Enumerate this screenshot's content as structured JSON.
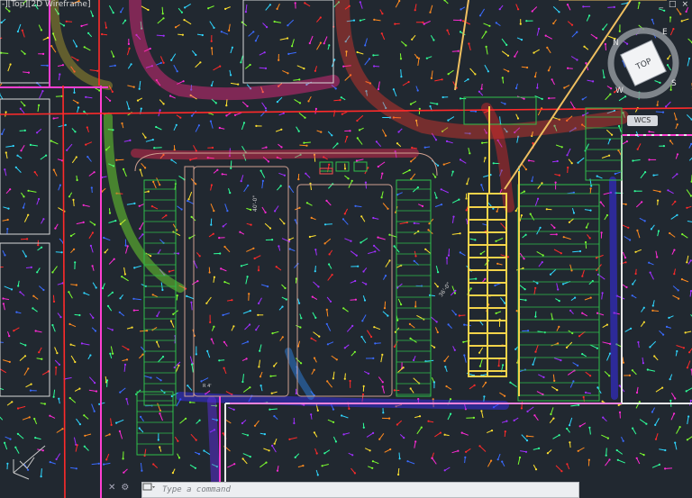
{
  "viewport": {
    "label_parts": [
      "-",
      "][Top][",
      "2D Wireframe",
      "]"
    ],
    "window_controls": [
      "_",
      "□",
      "×"
    ]
  },
  "viewcube": {
    "face": "TOP",
    "compass": [
      "N",
      "E",
      "S",
      "W"
    ]
  },
  "wcs_label": "WCS",
  "command_line": {
    "placeholder": "Type a command",
    "value": ""
  },
  "drawing_labels": {
    "vertical_dim": "40'-0\"",
    "diagonal_dim": "36'-0\"",
    "note": "R 4'"
  },
  "colors": {
    "background": "#212830",
    "property_line": "#ff2a2a",
    "setback_line": "#ff3fd2",
    "grid_green": "#2fbf4a",
    "accent_yellow": "#f2d34a"
  }
}
